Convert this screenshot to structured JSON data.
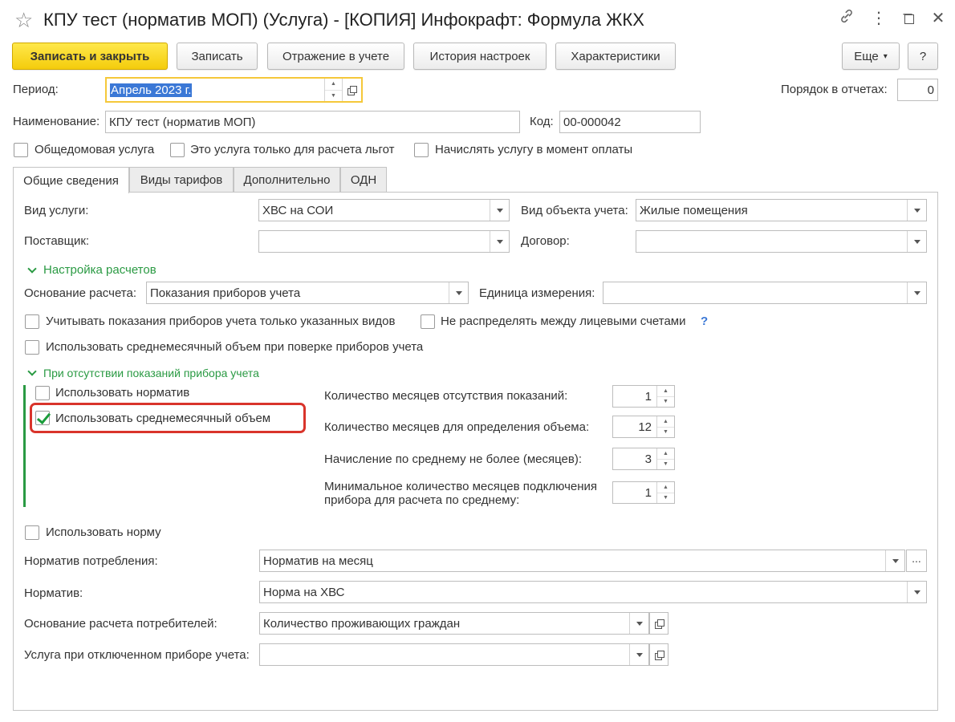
{
  "window": {
    "title": "КПУ тест (норматив МОП) (Услуга) - [КОПИЯ] Инфокрафт: Формула ЖКХ",
    "star_icon": "star-icon",
    "link_icon": "link-icon",
    "menu_icon": "more-vertical-icon",
    "minimize_icon": "minimize-icon",
    "maximize_icon": "maximize-icon",
    "close_icon": "close-icon"
  },
  "toolbar": {
    "save_close": "Записать и закрыть",
    "save": "Записать",
    "accounting": "Отражение в учете",
    "history": "История настроек",
    "characteristics": "Характеристики",
    "more": "Еще",
    "help": "?"
  },
  "header": {
    "period_label": "Период:",
    "period_value": "Апрель 2023 г.",
    "order_label": "Порядок в отчетах:",
    "order_value": "0",
    "name_label": "Наименование:",
    "name_value": "КПУ тест (норматив МОП)",
    "code_label": "Код:",
    "code_value": "00-000042",
    "cb_common": "Общедомовая услуга",
    "cb_benefits": "Это услуга только для расчета льгот",
    "cb_on_payment": "Начислять услугу в момент оплаты"
  },
  "tabs": [
    {
      "label": "Общие сведения"
    },
    {
      "label": "Виды тарифов"
    },
    {
      "label": "Дополнительно"
    },
    {
      "label": "ОДН"
    }
  ],
  "general": {
    "service_type_label": "Вид услуги:",
    "service_type_value": "ХВС на СОИ",
    "object_type_label": "Вид объекта учета:",
    "object_type_value": "Жилые помещения",
    "supplier_label": "Поставщик:",
    "supplier_value": "",
    "contract_label": "Договор:",
    "contract_value": "",
    "calc_section": "Настройка расчетов",
    "calc_basis_label": "Основание расчета:",
    "calc_basis_value": "Показания приборов учета",
    "unit_label": "Единица измерения:",
    "unit_value": "",
    "cb_only_types": "Учитывать показания приборов учета только указанных видов",
    "cb_no_distribute": "Не распределять между лицевыми счетами",
    "help_mark": "?",
    "cb_avg_verification": "Использовать среднемесячный объем при поверке приборов учета",
    "absence_section": "При отсутствии показаний прибора учета",
    "cb_use_normative": "Использовать норматив",
    "cb_use_average": "Использовать среднемесячный объем",
    "months_absent_label": "Количество месяцев отсутствия показаний:",
    "months_absent_value": "1",
    "months_volume_label": "Количество месяцев для определения объема:",
    "months_volume_value": "12",
    "avg_max_label": "Начисление по среднему не более (месяцев):",
    "avg_max_value": "3",
    "min_months_label_1": "Минимальное количество месяцев подключения",
    "min_months_label_2": "прибора для расчета по среднему:",
    "min_months_value": "1",
    "cb_use_norm": "Использовать норму",
    "consumption_norm_label": "Норматив потребления:",
    "consumption_norm_value": "Норматив на месяц",
    "normative_label": "Норматив:",
    "normative_value": "Норма на ХВС",
    "consumers_basis_label": "Основание расчета потребителей:",
    "consumers_basis_value": "Количество проживающих граждан",
    "disabled_meter_label": "Услуга при отключенном приборе учета:",
    "disabled_meter_value": ""
  },
  "colors": {
    "primary_button": "#f4cc0c",
    "section_green": "#2a9a43",
    "highlight_red": "#d9342b",
    "focus_yellow": "#f5c83a",
    "selection_blue": "#3b78d6"
  }
}
